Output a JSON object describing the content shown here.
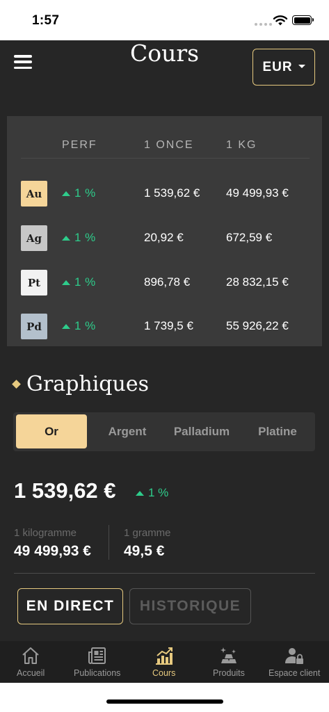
{
  "status_bar": {
    "time": "1:57"
  },
  "header": {
    "title": "Cours",
    "currency": "EUR"
  },
  "prices": {
    "columns": [
      "PERF",
      "1 ONCE",
      "1 KG"
    ],
    "rows": [
      {
        "symbol": "Au",
        "badge_color": "#f5d599",
        "perf": "1 %",
        "ounce": "1 539,62 €",
        "kg": "49 499,93 €"
      },
      {
        "symbol": "Ag",
        "badge_color": "#c7c7c7",
        "perf": "1 %",
        "ounce": "20,92 €",
        "kg": "672,59 €"
      },
      {
        "symbol": "Pt",
        "badge_color": "#f2f2f2",
        "perf": "1 %",
        "ounce": "896,78 €",
        "kg": "28 832,15 €"
      },
      {
        "symbol": "Pd",
        "badge_color": "#b3c0cc",
        "perf": "1 %",
        "ounce": "1 739,5 €",
        "kg": "55 926,22 €"
      }
    ]
  },
  "charts": {
    "section_title": "Graphiques",
    "tabs": [
      "Or",
      "Argent",
      "Palladium",
      "Platine"
    ],
    "active_tab": "Or",
    "price": "1 539,62 €",
    "perf": "1 %",
    "kilogram_label": "1 kilogramme",
    "kilogram_value": "49 499,93 €",
    "gram_label": "1 gramme",
    "gram_value": "49,5 €",
    "live_button": "EN DIRECT",
    "history_button": "HISTORIQUE"
  },
  "tabbar": {
    "items": [
      {
        "label": "Accueil",
        "icon": "home-icon"
      },
      {
        "label": "Publications",
        "icon": "newspaper-icon"
      },
      {
        "label": "Cours",
        "icon": "chart-icon"
      },
      {
        "label": "Produits",
        "icon": "gold-bars-icon"
      },
      {
        "label": "Espace client",
        "icon": "user-lock-icon"
      }
    ],
    "active": "Cours"
  },
  "colors": {
    "accent": "#e6c97f",
    "positive": "#2ecc8b",
    "background": "#262626"
  }
}
